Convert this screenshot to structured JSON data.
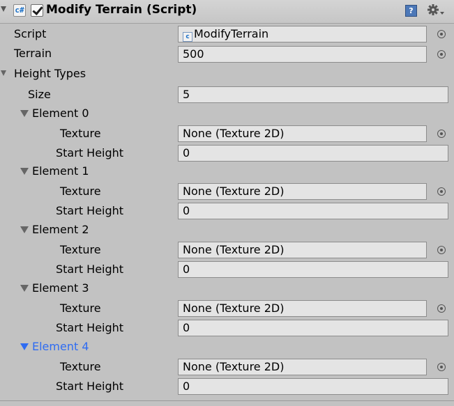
{
  "component": {
    "title": "Modify Terrain (Script)",
    "icon": "script-icon",
    "enabled": true
  },
  "script": {
    "label": "Script",
    "value": "ModifyTerrain"
  },
  "terrain": {
    "label": "Terrain",
    "value": "500"
  },
  "height_types": {
    "label": "Height Types",
    "size_label": "Size",
    "size_value": "5",
    "elements": [
      {
        "label": "Element 0",
        "texture_label": "Texture",
        "texture_value": "None (Texture 2D)",
        "start_height_label": "Start Height",
        "start_height_value": "0"
      },
      {
        "label": "Element 1",
        "texture_label": "Texture",
        "texture_value": "None (Texture 2D)",
        "start_height_label": "Start Height",
        "start_height_value": "0"
      },
      {
        "label": "Element 2",
        "texture_label": "Texture",
        "texture_value": "None (Texture 2D)",
        "start_height_label": "Start Height",
        "start_height_value": "0"
      },
      {
        "label": "Element 3",
        "texture_label": "Texture",
        "texture_value": "None (Texture 2D)",
        "start_height_label": "Start Height",
        "start_height_value": "0"
      },
      {
        "label": "Element 4",
        "texture_label": "Texture",
        "texture_value": "None (Texture 2D)",
        "start_height_label": "Start Height",
        "start_height_value": "0"
      }
    ]
  },
  "colors": {
    "panel_background": "#c2c2c2",
    "field_background": "#e4e4e4",
    "selected_element": "#2f6cf2"
  }
}
